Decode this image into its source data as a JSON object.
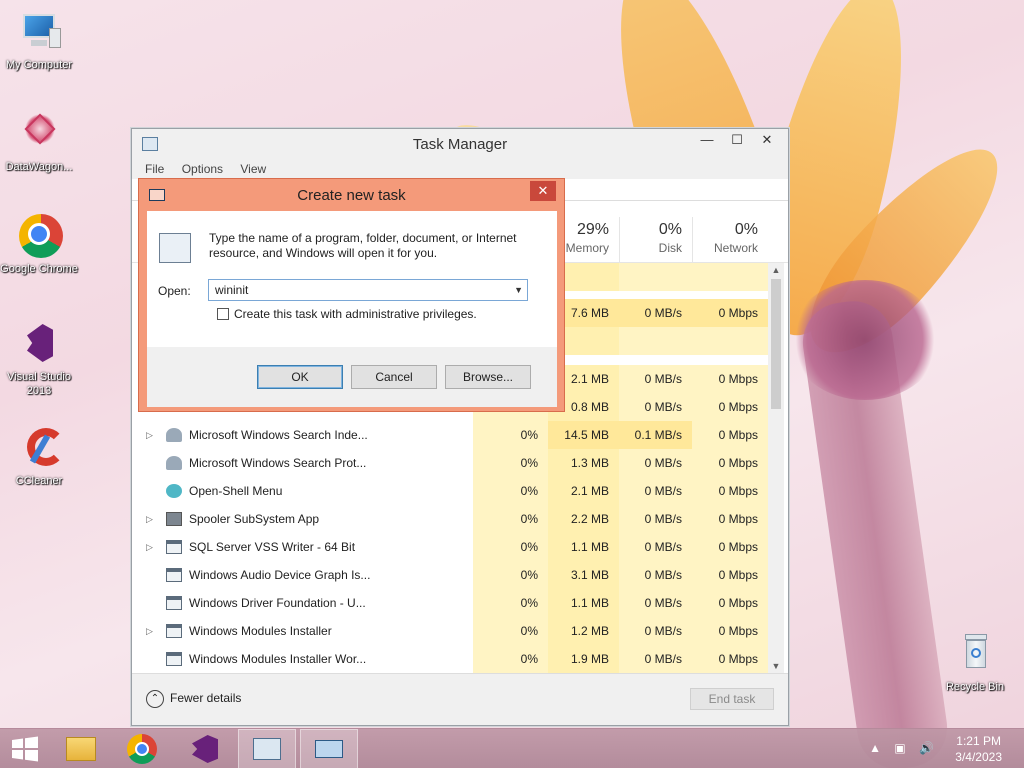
{
  "desktop": {
    "icons": [
      {
        "label": "My Computer"
      },
      {
        "label": "DataWagon..."
      },
      {
        "label": "Google Chrome"
      },
      {
        "label": "Visual Studio 2013"
      },
      {
        "label": "CCleaner"
      },
      {
        "label": "Recycle Bin"
      }
    ]
  },
  "task_manager": {
    "title": "Task Manager",
    "menu": [
      "File",
      "Options",
      "View"
    ],
    "columns": [
      {
        "pct": "29%",
        "label": "Memory"
      },
      {
        "pct": "0%",
        "label": "Disk"
      },
      {
        "pct": "0%",
        "label": "Network"
      }
    ],
    "partial_rows": [
      {
        "mem": "7.6 MB",
        "disk": "0 MB/s",
        "net": "0 Mbps"
      },
      {
        "mem": "2.1 MB",
        "disk": "0 MB/s",
        "net": "0 Mbps"
      },
      {
        "mem": "0.8 MB",
        "disk": "0 MB/s",
        "net": "0 Mbps"
      }
    ],
    "rows": [
      {
        "name": "Microsoft Windows Search Inde...",
        "cpu": "0%",
        "mem": "14.5 MB",
        "disk": "0.1 MB/s",
        "net": "0 Mbps"
      },
      {
        "name": "Microsoft Windows Search Prot...",
        "cpu": "0%",
        "mem": "1.3 MB",
        "disk": "0 MB/s",
        "net": "0 Mbps"
      },
      {
        "name": "Open-Shell Menu",
        "cpu": "0%",
        "mem": "2.1 MB",
        "disk": "0 MB/s",
        "net": "0 Mbps"
      },
      {
        "name": "Spooler SubSystem App",
        "cpu": "0%",
        "mem": "2.2 MB",
        "disk": "0 MB/s",
        "net": "0 Mbps"
      },
      {
        "name": "SQL Server VSS Writer - 64 Bit",
        "cpu": "0%",
        "mem": "1.1 MB",
        "disk": "0 MB/s",
        "net": "0 Mbps"
      },
      {
        "name": "Windows Audio Device Graph Is...",
        "cpu": "0%",
        "mem": "3.1 MB",
        "disk": "0 MB/s",
        "net": "0 Mbps"
      },
      {
        "name": "Windows Driver Foundation - U...",
        "cpu": "0%",
        "mem": "1.1 MB",
        "disk": "0 MB/s",
        "net": "0 Mbps"
      },
      {
        "name": "Windows Modules Installer",
        "cpu": "0%",
        "mem": "1.2 MB",
        "disk": "0 MB/s",
        "net": "0 Mbps"
      },
      {
        "name": "Windows Modules Installer Wor...",
        "cpu": "0%",
        "mem": "1.9 MB",
        "disk": "0 MB/s",
        "net": "0 Mbps"
      }
    ],
    "footer": {
      "fewer_details": "Fewer details",
      "end_task": "End task"
    }
  },
  "dialog": {
    "title": "Create new task",
    "description": "Type the name of a program, folder, document, or Internet resource, and Windows will open it for you.",
    "open_label": "Open:",
    "open_value": "wininit",
    "admin_checkbox": "Create this task with administrative privileges.",
    "ok": "OK",
    "cancel": "Cancel",
    "browse": "Browse..."
  },
  "taskbar": {
    "time": "1:21 PM",
    "date": "3/4/2023"
  }
}
